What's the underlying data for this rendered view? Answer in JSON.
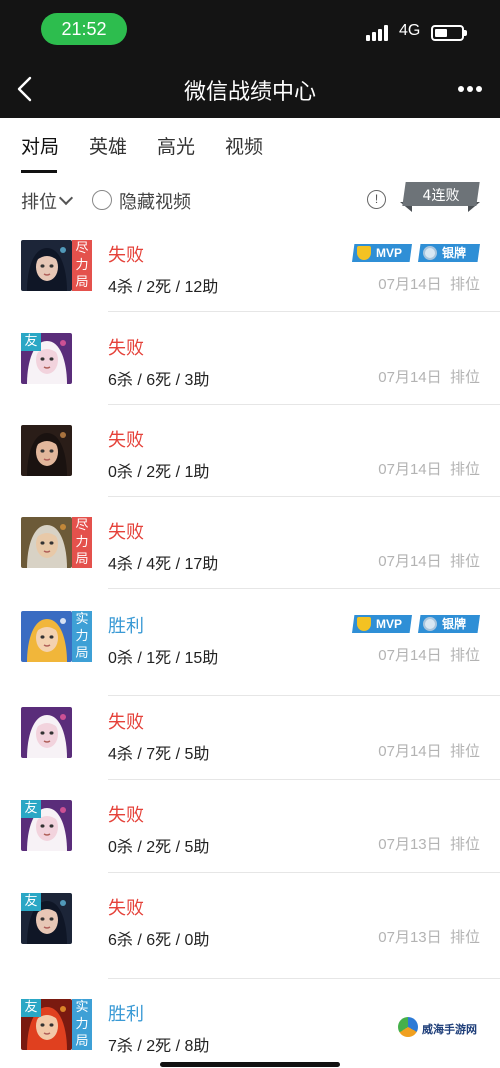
{
  "status_bar": {
    "time": "21:52",
    "network": "4G"
  },
  "nav": {
    "title": "微信战绩中心",
    "back_icon": "chevron-left-icon",
    "more_icon": "more-dots-icon"
  },
  "tabs": [
    {
      "label": "对局",
      "active": true
    },
    {
      "label": "英雄",
      "active": false
    },
    {
      "label": "高光",
      "active": false
    },
    {
      "label": "视频",
      "active": false
    }
  ],
  "filter": {
    "rank_label": "排位",
    "hide_video_label": "隐藏视频",
    "info_icon": "!",
    "streak_label": "4连败"
  },
  "colors": {
    "lose": "#e5423a",
    "win": "#3a9ad5",
    "accent": "#2dbd4e",
    "tag_red": "#e4514c",
    "tag_blue": "#3ea0d6",
    "tag_cyan": "#2aa7c5"
  },
  "matches": [
    {
      "result": "失败",
      "kda": "4杀 / 2死 / 12助",
      "date": "07月14日",
      "mode": "排位",
      "tag": [
        "尽",
        "力",
        "局"
      ],
      "tag_color": "#e4514c",
      "friend": "",
      "mvp": "MVP",
      "medal": "银牌",
      "hero": "dark-hair-female"
    },
    {
      "result": "失败",
      "kda": "6杀 / 6死 / 3助",
      "date": "07月14日",
      "mode": "排位",
      "tag": [],
      "friend": "友",
      "mvp": "",
      "medal": "",
      "hero": "pink-white-female"
    },
    {
      "result": "失败",
      "kda": "0杀 / 2死 / 1助",
      "date": "07月14日",
      "mode": "排位",
      "tag": [],
      "friend": "",
      "mvp": "",
      "medal": "",
      "hero": "dark-hair-female-2"
    },
    {
      "result": "失败",
      "kda": "4杀 / 4死 / 17助",
      "date": "07月14日",
      "mode": "排位",
      "tag": [
        "尽",
        "力",
        "局"
      ],
      "tag_color": "#e4514c",
      "friend": "",
      "mvp": "",
      "medal": "",
      "hero": "silver-hair-male"
    },
    {
      "result": "胜利",
      "kda": "0杀 / 1死 / 15助",
      "date": "07月14日",
      "mode": "排位",
      "tag": [
        "实",
        "力",
        "局"
      ],
      "tag_color": "#3ea0d6",
      "friend": "",
      "mvp": "MVP",
      "medal": "银牌",
      "hero": "blonde-child"
    },
    {
      "result": "失败",
      "kda": "4杀 / 7死 / 5助",
      "date": "07月14日",
      "mode": "排位",
      "tag": [],
      "friend": "",
      "mvp": "",
      "medal": "",
      "hero": "pink-white-female"
    },
    {
      "result": "失败",
      "kda": "0杀 / 2死 / 5助",
      "date": "07月13日",
      "mode": "排位",
      "tag": [],
      "friend": "友",
      "mvp": "",
      "medal": "",
      "hero": "pink-white-female"
    },
    {
      "result": "失败",
      "kda": "6杀 / 6死 / 0助",
      "date": "07月13日",
      "mode": "排位",
      "tag": [],
      "friend": "友",
      "mvp": "",
      "medal": "",
      "hero": "dark-hair-female"
    },
    {
      "result": "胜利",
      "kda": "7杀 / 2死 / 8助",
      "date": "",
      "mode": "",
      "tag": [
        "实",
        "力",
        "局"
      ],
      "tag_color": "#3ea0d6",
      "friend": "友",
      "mvp": "",
      "medal": "",
      "hero": "red-hair-female"
    }
  ],
  "watermark": {
    "text": "威海手游网"
  }
}
